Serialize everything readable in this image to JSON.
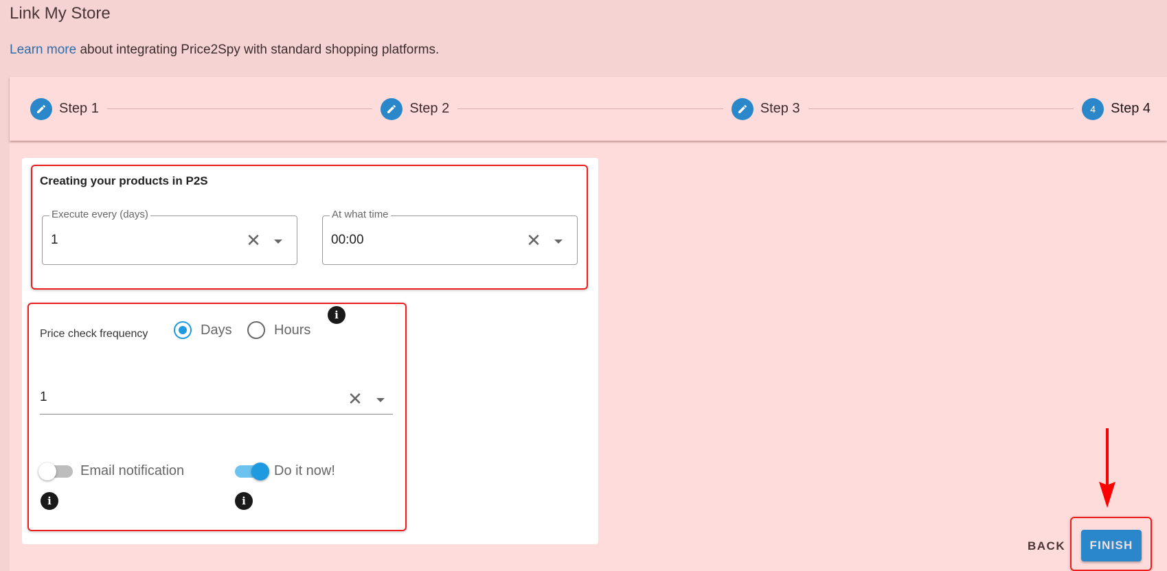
{
  "page": {
    "title": "Link My Store",
    "intro_link": "Learn more",
    "intro_text": " about integrating Price2Spy with standard shopping platforms."
  },
  "stepper": {
    "steps": [
      {
        "label": "Step 1",
        "icon": "pencil-icon",
        "state": "completed"
      },
      {
        "label": "Step 2",
        "icon": "pencil-icon",
        "state": "completed"
      },
      {
        "label": "Step 3",
        "icon": "pencil-icon",
        "state": "completed"
      },
      {
        "label": "Step 4",
        "number": "4",
        "state": "active"
      }
    ]
  },
  "create_products": {
    "title": "Creating your products in P2S",
    "execute_every": {
      "label": "Execute every (days)",
      "value": "1"
    },
    "at_what_time": {
      "label": "At what time",
      "value": "00:00"
    }
  },
  "price_check": {
    "label": "Price check frequency",
    "options": [
      {
        "label": "Days",
        "checked": true
      },
      {
        "label": "Hours",
        "checked": false
      }
    ],
    "value": "1",
    "email_notification": {
      "label": "Email notification",
      "on": false
    },
    "do_it_now": {
      "label": "Do it now!",
      "on": true
    }
  },
  "actions": {
    "back_label": "BACK",
    "finish_label": "FINISH"
  },
  "colors": {
    "accent": "#2a87c9",
    "toggle_on": "#1e9be0",
    "highlight": "#ee1c1c",
    "background": "#f5d3d3"
  },
  "icons": {
    "clear": "✕",
    "info": "i"
  }
}
